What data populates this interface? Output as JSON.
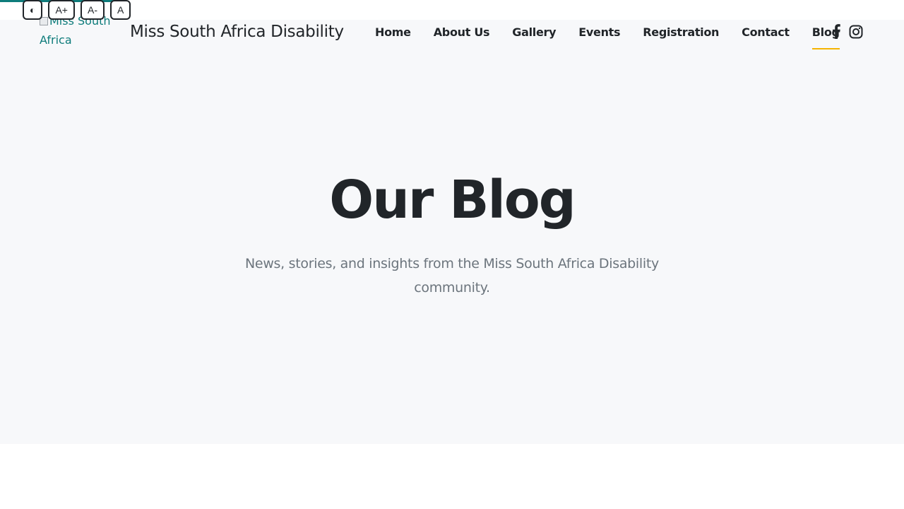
{
  "accessibility": {
    "contrast_label": "◐",
    "increase_label": "A+",
    "decrease_label": "A-",
    "reset_label": "A"
  },
  "header": {
    "logo_alt": "Miss South Africa",
    "site_title": "Miss South Africa Disability",
    "nav": [
      {
        "label": "Home"
      },
      {
        "label": "About Us"
      },
      {
        "label": "Gallery"
      },
      {
        "label": "Events"
      },
      {
        "label": "Registration"
      },
      {
        "label": "Contact"
      },
      {
        "label": "Blog",
        "active": true
      }
    ],
    "social_icons": [
      "facebook-icon",
      "instagram-icon"
    ]
  },
  "hero": {
    "title": "Our Blog",
    "subtitle": "News, stories, and insights from the Miss South Africa Disability community."
  },
  "colors": {
    "accent": "#0e7c7b",
    "active_underline": "#f5b301",
    "hero_bg": "#f7f8fa",
    "text_dark": "#212529",
    "text_muted": "#6c757d"
  }
}
